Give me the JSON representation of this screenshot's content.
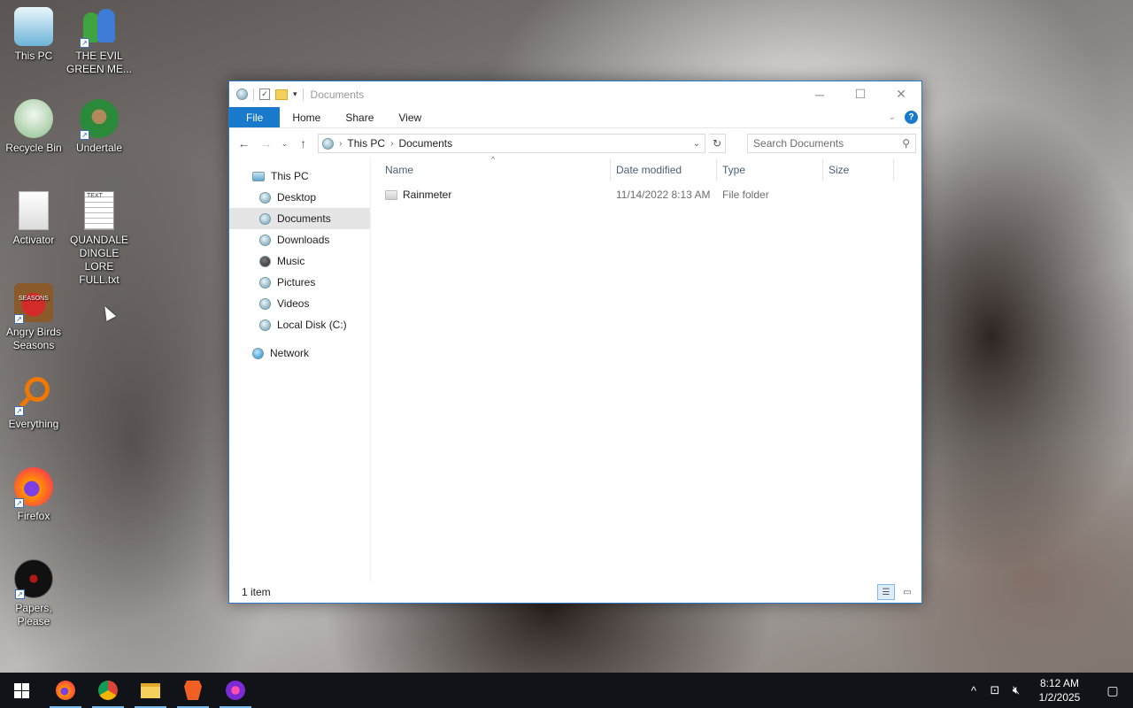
{
  "desktop": {
    "icons": [
      {
        "label": "This PC"
      },
      {
        "label": "THE EVIL GREEN ME..."
      },
      {
        "label": "Recycle Bin"
      },
      {
        "label": "Undertale"
      },
      {
        "label": "Activator"
      },
      {
        "label": "QUANDALE DINGLE LORE FULL.txt",
        "badge": "TEXT"
      },
      {
        "label": "Angry Birds Seasons",
        "badge": "SEASONS"
      },
      {
        "label": "Everything"
      },
      {
        "label": "Firefox"
      },
      {
        "label": "Papers, Please"
      }
    ]
  },
  "window": {
    "title": "Documents",
    "ribbon": {
      "file": "File",
      "home": "Home",
      "share": "Share",
      "view": "View",
      "help": "?"
    },
    "address": {
      "root": "This PC",
      "current": "Documents"
    },
    "search": {
      "placeholder": "Search Documents"
    },
    "nav": {
      "this_pc": "This PC",
      "items": [
        "Desktop",
        "Documents",
        "Downloads",
        "Music",
        "Pictures",
        "Videos",
        "Local Disk (C:)"
      ],
      "selected": "Documents",
      "network": "Network"
    },
    "columns": {
      "name": "Name",
      "date": "Date modified",
      "type": "Type",
      "size": "Size"
    },
    "files": [
      {
        "name": "Rainmeter",
        "date": "11/14/2022 8:13 AM",
        "type": "File folder",
        "size": ""
      }
    ],
    "status": "1 item"
  },
  "taskbar": {
    "apps": [
      "start",
      "firefox",
      "chrome",
      "file-explorer",
      "brave",
      "app"
    ],
    "clock": {
      "time": "8:12 AM",
      "date": "1/2/2025"
    }
  }
}
